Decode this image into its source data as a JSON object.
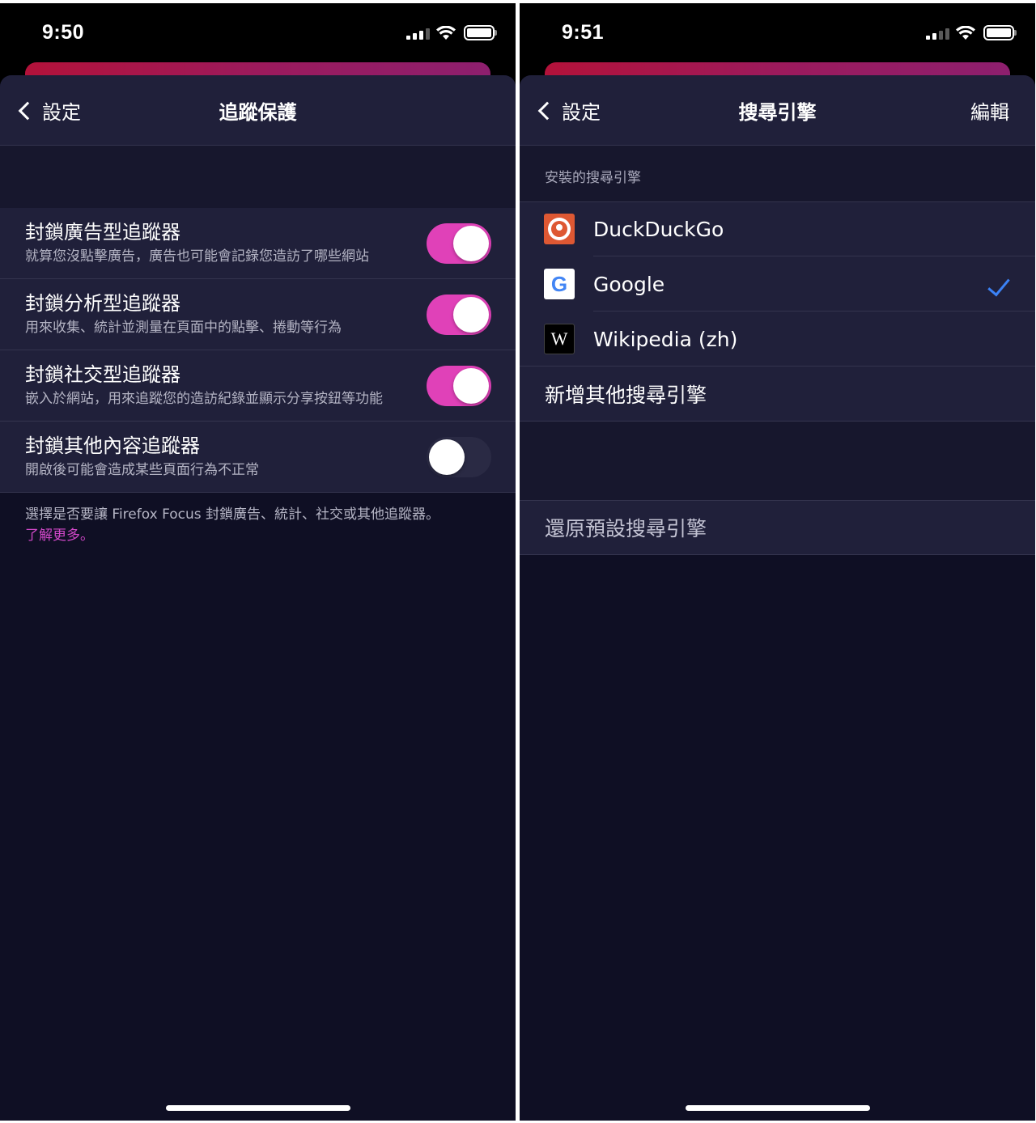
{
  "left": {
    "status": {
      "time": "9:50"
    },
    "nav": {
      "back_label": "設定",
      "title": "追蹤保護"
    },
    "toggles": [
      {
        "title": "封鎖廣告型追蹤器",
        "subtitle": "就算您沒點擊廣告，廣告也可能會記錄您造訪了哪些網站",
        "on": true
      },
      {
        "title": "封鎖分析型追蹤器",
        "subtitle": "用來收集、統計並測量在頁面中的點擊、捲動等行為",
        "on": true
      },
      {
        "title": "封鎖社交型追蹤器",
        "subtitle": "嵌入於網站，用來追蹤您的造訪紀錄並顯示分享按鈕等功能",
        "on": true
      },
      {
        "title": "封鎖其他內容追蹤器",
        "subtitle": "開啟後可能會造成某些頁面行為不正常",
        "on": false
      }
    ],
    "footer": {
      "text": "選擇是否要讓 Firefox Focus 封鎖廣告、統計、社交或其他追蹤器。",
      "link": "了解更多。"
    }
  },
  "right": {
    "status": {
      "time": "9:51"
    },
    "nav": {
      "back_label": "設定",
      "title": "搜尋引擎",
      "edit_label": "編輯"
    },
    "section_header": "安裝的搜尋引擎",
    "engines": [
      {
        "name": "DuckDuckGo",
        "icon": "duckduckgo-icon",
        "selected": false
      },
      {
        "name": "Google",
        "icon": "google-icon",
        "selected": true
      },
      {
        "name": "Wikipedia (zh)",
        "icon": "wikipedia-icon",
        "selected": false
      }
    ],
    "add_engine_label": "新增其他搜尋引擎",
    "restore_label": "還原預設搜尋引擎"
  },
  "colors": {
    "toggle_on": "#e041b8",
    "check_blue": "#3b82f6",
    "link_pink": "#d048c8",
    "background": "#0f0f24",
    "row_background": "#20203a"
  }
}
